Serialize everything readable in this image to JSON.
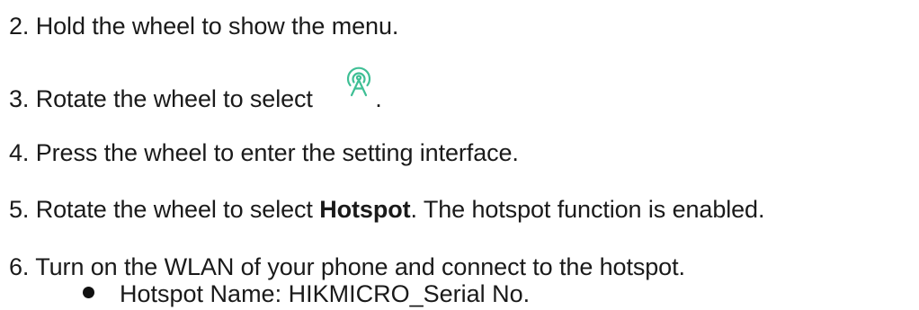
{
  "steps": [
    {
      "num": "2.",
      "text": " Hold the wheel to show the menu."
    },
    {
      "num": "3.",
      "text_before": " Rotate the wheel to select ",
      "text_after": "."
    },
    {
      "num": "4.",
      "text": " Press the wheel to enter the setting interface."
    },
    {
      "num": "5.",
      "text_before": " Rotate the wheel to select ",
      "bold": "Hotspot",
      "text_after": ". The hotspot function is enabled."
    },
    {
      "num": "6.",
      "text": " Turn on the WLAN of your phone and connect to the hotspot."
    }
  ],
  "bullets": [
    {
      "text": "Hotspot Name: HIKMICRO_Serial No."
    }
  ],
  "icons": {
    "hotspot": "hotspot-icon"
  },
  "colors": {
    "icon": "#3fbf95",
    "text": "#1a1a1a"
  }
}
